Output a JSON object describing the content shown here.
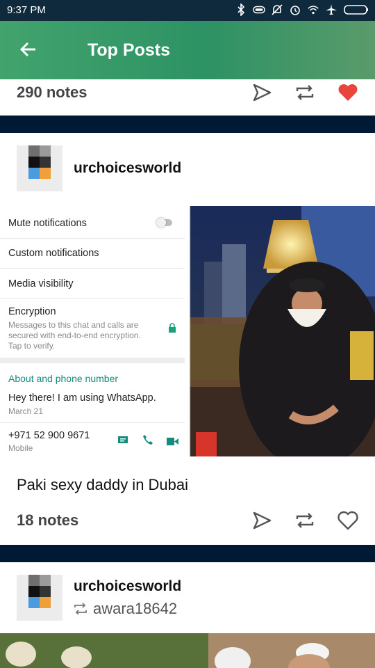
{
  "status": {
    "time": "9:37 PM"
  },
  "header": {
    "title": "Top Posts"
  },
  "post1": {
    "notes": "290 notes"
  },
  "post2": {
    "username": "urchoicesworld",
    "caption": "Paki sexy daddy in Dubai",
    "notes": "18 notes",
    "screenshot": {
      "mute": "Mute notifications",
      "custom": "Custom notifications",
      "media": "Media visibility",
      "encryption": "Encryption",
      "enc_line1": "Messages to this chat and calls are",
      "enc_line2": "secured with end-to-end encryption.",
      "enc_line3": "Tap to verify.",
      "about_header": "About and phone number",
      "about_text": "Hey there! I am using WhatsApp.",
      "about_date": "March 21",
      "phone": "+971 52 900 9671",
      "phone_type": "Mobile"
    }
  },
  "post3": {
    "username": "urchoicesworld",
    "reblogged_from": "awara18642"
  },
  "colors": {
    "accent_green": "#2d9264",
    "heart_red": "#e8453c",
    "navy": "#001935"
  }
}
